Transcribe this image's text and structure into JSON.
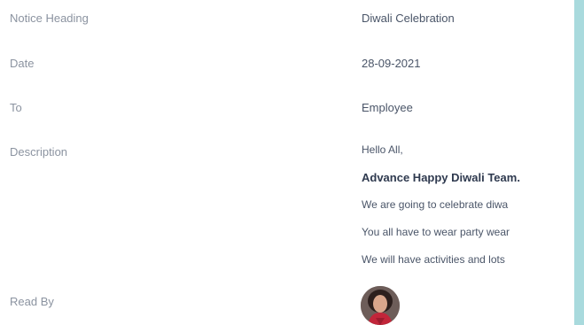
{
  "notice": {
    "heading_label": "Notice Heading",
    "heading_value": "Diwali Celebration",
    "date_label": "Date",
    "date_value": "28-09-2021",
    "to_label": "To",
    "to_value": "Employee",
    "description_label": "Description",
    "description_lines": [
      "Hello All,",
      "Advance Happy Diwali Team.",
      "We are going to celebrate diwa",
      "You all have to wear party wear",
      "We will have activities and lots"
    ],
    "read_by_label": "Read By"
  },
  "colors": {
    "label": "#8b93a0",
    "value": "#4a5568",
    "accent_strip": "#a9dadd"
  }
}
